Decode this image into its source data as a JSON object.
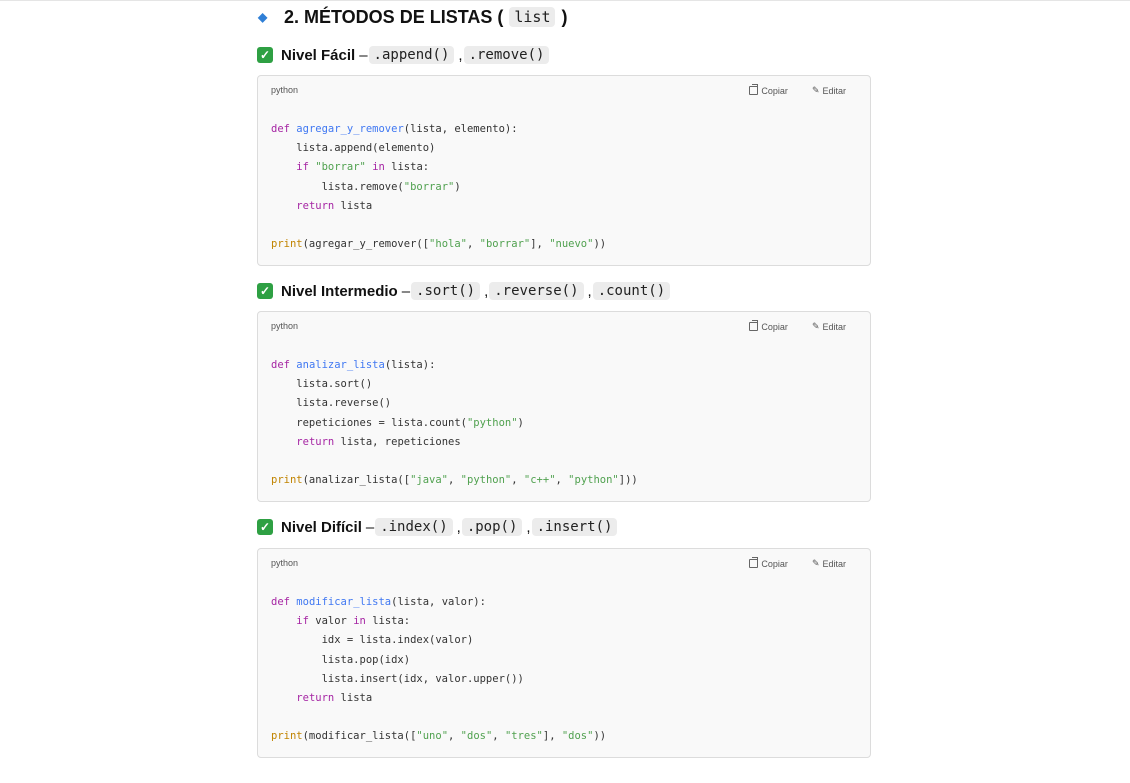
{
  "section": {
    "icon": "blue-diamond-icon",
    "title_prefix": "2. MÉTODOS DE LISTAS (",
    "title_code": "list",
    "title_suffix": ")"
  },
  "labels": {
    "copy": "Copiar",
    "edit": "Editar"
  },
  "colors": {
    "check": "#2ea043",
    "keyword": "#a626a4",
    "function": "#4078f2",
    "string": "#50a14f",
    "builtin": "#c18401",
    "diamond": "#2f7fd6"
  },
  "blocks": [
    {
      "level": "Nivel Fácil",
      "dash": " – ",
      "methods": [
        ".append()",
        ".remove()"
      ],
      "lang": "python",
      "code": [
        [
          [
            "kw",
            "def"
          ],
          [
            "t",
            " "
          ],
          [
            "fn",
            "agregar_y_remover"
          ],
          [
            "t",
            "(lista, elemento):"
          ]
        ],
        [
          [
            "t",
            "    lista.append(elemento)"
          ]
        ],
        [
          [
            "t",
            "    "
          ],
          [
            "kw",
            "if"
          ],
          [
            "t",
            " "
          ],
          [
            "str",
            "\"borrar\""
          ],
          [
            "t",
            " "
          ],
          [
            "kw",
            "in"
          ],
          [
            "t",
            " lista:"
          ]
        ],
        [
          [
            "t",
            "        lista.remove("
          ],
          [
            "str",
            "\"borrar\""
          ],
          [
            "t",
            ")"
          ]
        ],
        [
          [
            "t",
            "    "
          ],
          [
            "kw",
            "return"
          ],
          [
            "t",
            " lista"
          ]
        ],
        [],
        [
          [
            "bi",
            "print"
          ],
          [
            "t",
            "(agregar_y_remover(["
          ],
          [
            "str",
            "\"hola\""
          ],
          [
            "t",
            ", "
          ],
          [
            "str",
            "\"borrar\""
          ],
          [
            "t",
            "], "
          ],
          [
            "str",
            "\"nuevo\""
          ],
          [
            "t",
            "))"
          ]
        ]
      ]
    },
    {
      "level": "Nivel Intermedio",
      "dash": " – ",
      "methods": [
        ".sort()",
        ".reverse()",
        ".count()"
      ],
      "lang": "python",
      "code": [
        [
          [
            "kw",
            "def"
          ],
          [
            "t",
            " "
          ],
          [
            "fn",
            "analizar_lista"
          ],
          [
            "t",
            "(lista):"
          ]
        ],
        [
          [
            "t",
            "    lista.sort()"
          ]
        ],
        [
          [
            "t",
            "    lista.reverse()"
          ]
        ],
        [
          [
            "t",
            "    repeticiones = lista.count("
          ],
          [
            "str",
            "\"python\""
          ],
          [
            "t",
            ")"
          ]
        ],
        [
          [
            "t",
            "    "
          ],
          [
            "kw",
            "return"
          ],
          [
            "t",
            " lista, repeticiones"
          ]
        ],
        [],
        [
          [
            "bi",
            "print"
          ],
          [
            "t",
            "(analizar_lista(["
          ],
          [
            "str",
            "\"java\""
          ],
          [
            "t",
            ", "
          ],
          [
            "str",
            "\"python\""
          ],
          [
            "t",
            ", "
          ],
          [
            "str",
            "\"c++\""
          ],
          [
            "t",
            ", "
          ],
          [
            "str",
            "\"python\""
          ],
          [
            "t",
            "]))"
          ]
        ]
      ]
    },
    {
      "level": "Nivel Difícil",
      "dash": " – ",
      "methods": [
        ".index()",
        ".pop()",
        ".insert()"
      ],
      "lang": "python",
      "code": [
        [
          [
            "kw",
            "def"
          ],
          [
            "t",
            " "
          ],
          [
            "fn",
            "modificar_lista"
          ],
          [
            "t",
            "(lista, valor):"
          ]
        ],
        [
          [
            "t",
            "    "
          ],
          [
            "kw",
            "if"
          ],
          [
            "t",
            " valor "
          ],
          [
            "kw",
            "in"
          ],
          [
            "t",
            " lista:"
          ]
        ],
        [
          [
            "t",
            "        idx = lista.index(valor)"
          ]
        ],
        [
          [
            "t",
            "        lista.pop(idx)"
          ]
        ],
        [
          [
            "t",
            "        lista.insert(idx, valor.upper())"
          ]
        ],
        [
          [
            "t",
            "    "
          ],
          [
            "kw",
            "return"
          ],
          [
            "t",
            " lista"
          ]
        ],
        [],
        [
          [
            "bi",
            "print"
          ],
          [
            "t",
            "(modificar_lista(["
          ],
          [
            "str",
            "\"uno\""
          ],
          [
            "t",
            ", "
          ],
          [
            "str",
            "\"dos\""
          ],
          [
            "t",
            ", "
          ],
          [
            "str",
            "\"tres\""
          ],
          [
            "t",
            "], "
          ],
          [
            "str",
            "\"dos\""
          ],
          [
            "t",
            "))"
          ]
        ]
      ]
    }
  ]
}
